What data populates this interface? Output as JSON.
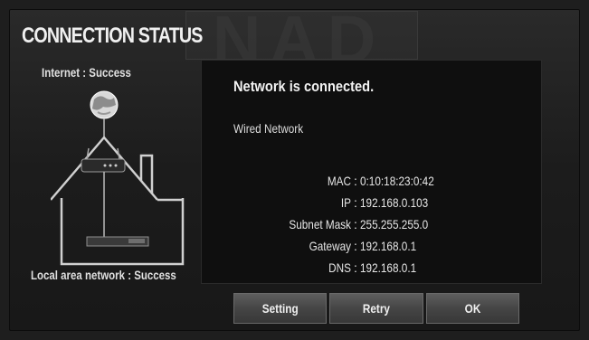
{
  "header": {
    "title": "CONNECTION STATUS",
    "brand_watermark": "NAD"
  },
  "diagram": {
    "internet_status": "Internet : Success",
    "lan_status": "Local area network : Success",
    "icons": [
      "globe-icon",
      "router-icon",
      "house-icon",
      "player-device-icon"
    ]
  },
  "dialog": {
    "message": "Network is connected.",
    "connection_type": "Wired Network",
    "info": [
      {
        "label": "MAC",
        "value": "0:10:18:23:0:42"
      },
      {
        "label": "IP",
        "value": "192.168.0.103"
      },
      {
        "label": "Subnet Mask",
        "value": "255.255.255.0"
      },
      {
        "label": "Gateway",
        "value": "192.168.0.1"
      },
      {
        "label": "DNS",
        "value": "192.168.0.1"
      }
    ],
    "separator": ":"
  },
  "buttons": {
    "setting": "Setting",
    "retry": "Retry",
    "ok": "OK"
  },
  "colors": {
    "background": "#1e1e1e",
    "dialog": "#0f0f0f",
    "button": "#454545",
    "text": "#f0f0f0"
  }
}
